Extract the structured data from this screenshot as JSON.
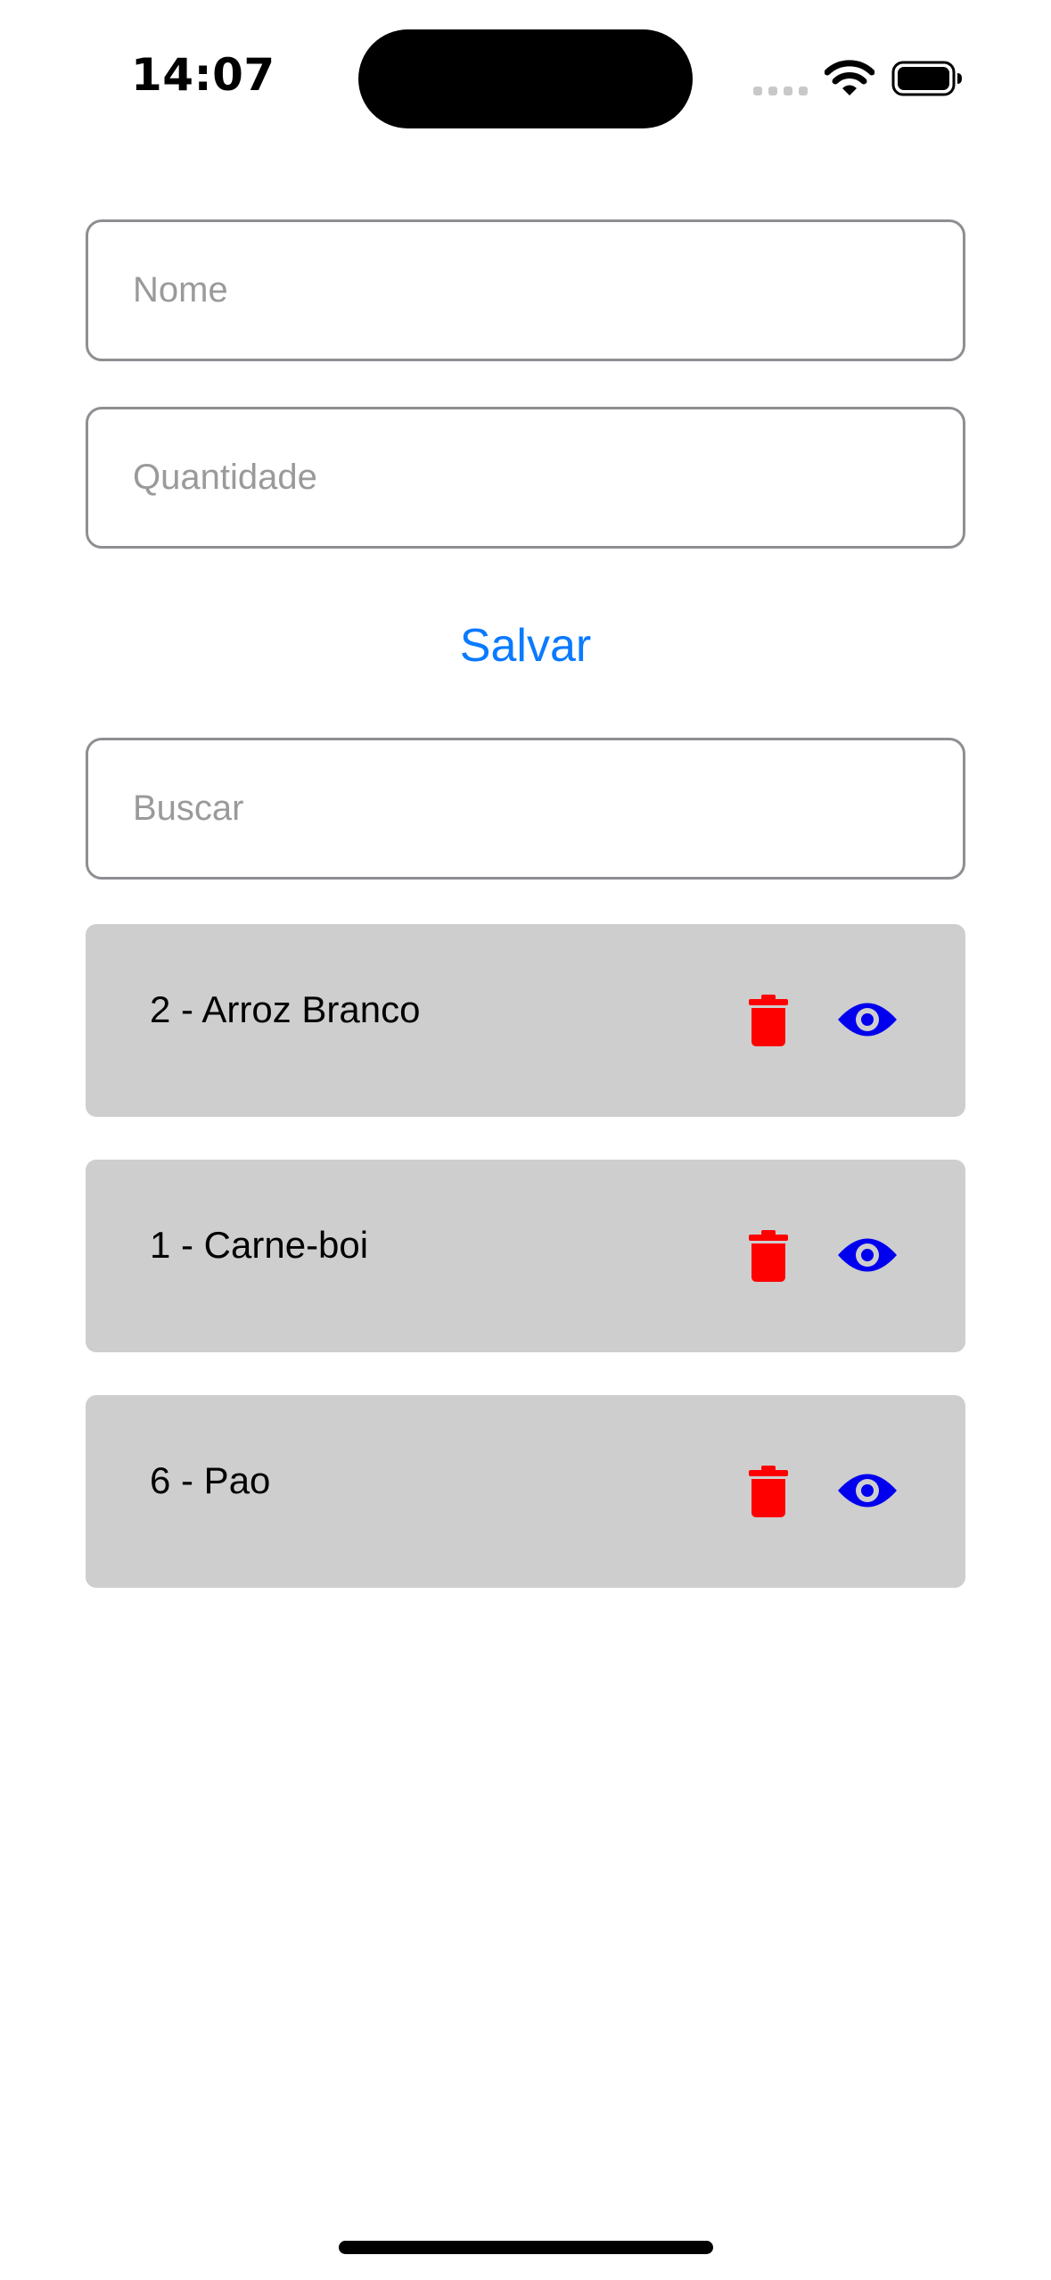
{
  "status_bar": {
    "time": "14:07"
  },
  "form": {
    "name_placeholder": "Nome",
    "quantity_placeholder": "Quantidade",
    "save_label": "Salvar",
    "search_placeholder": "Buscar"
  },
  "items": [
    {
      "label": "2 - Arroz Branco"
    },
    {
      "label": "1 - Carne-boi"
    },
    {
      "label": "6 - Pao"
    }
  ],
  "icons": {
    "delete": "trash-icon",
    "view": "eye-icon"
  },
  "colors": {
    "accent": "#0a7aff",
    "delete": "#ff0000",
    "view": "#0000ee",
    "item_background": "#cecece",
    "input_border": "#8e8e93",
    "placeholder": "#9a9a9a"
  }
}
